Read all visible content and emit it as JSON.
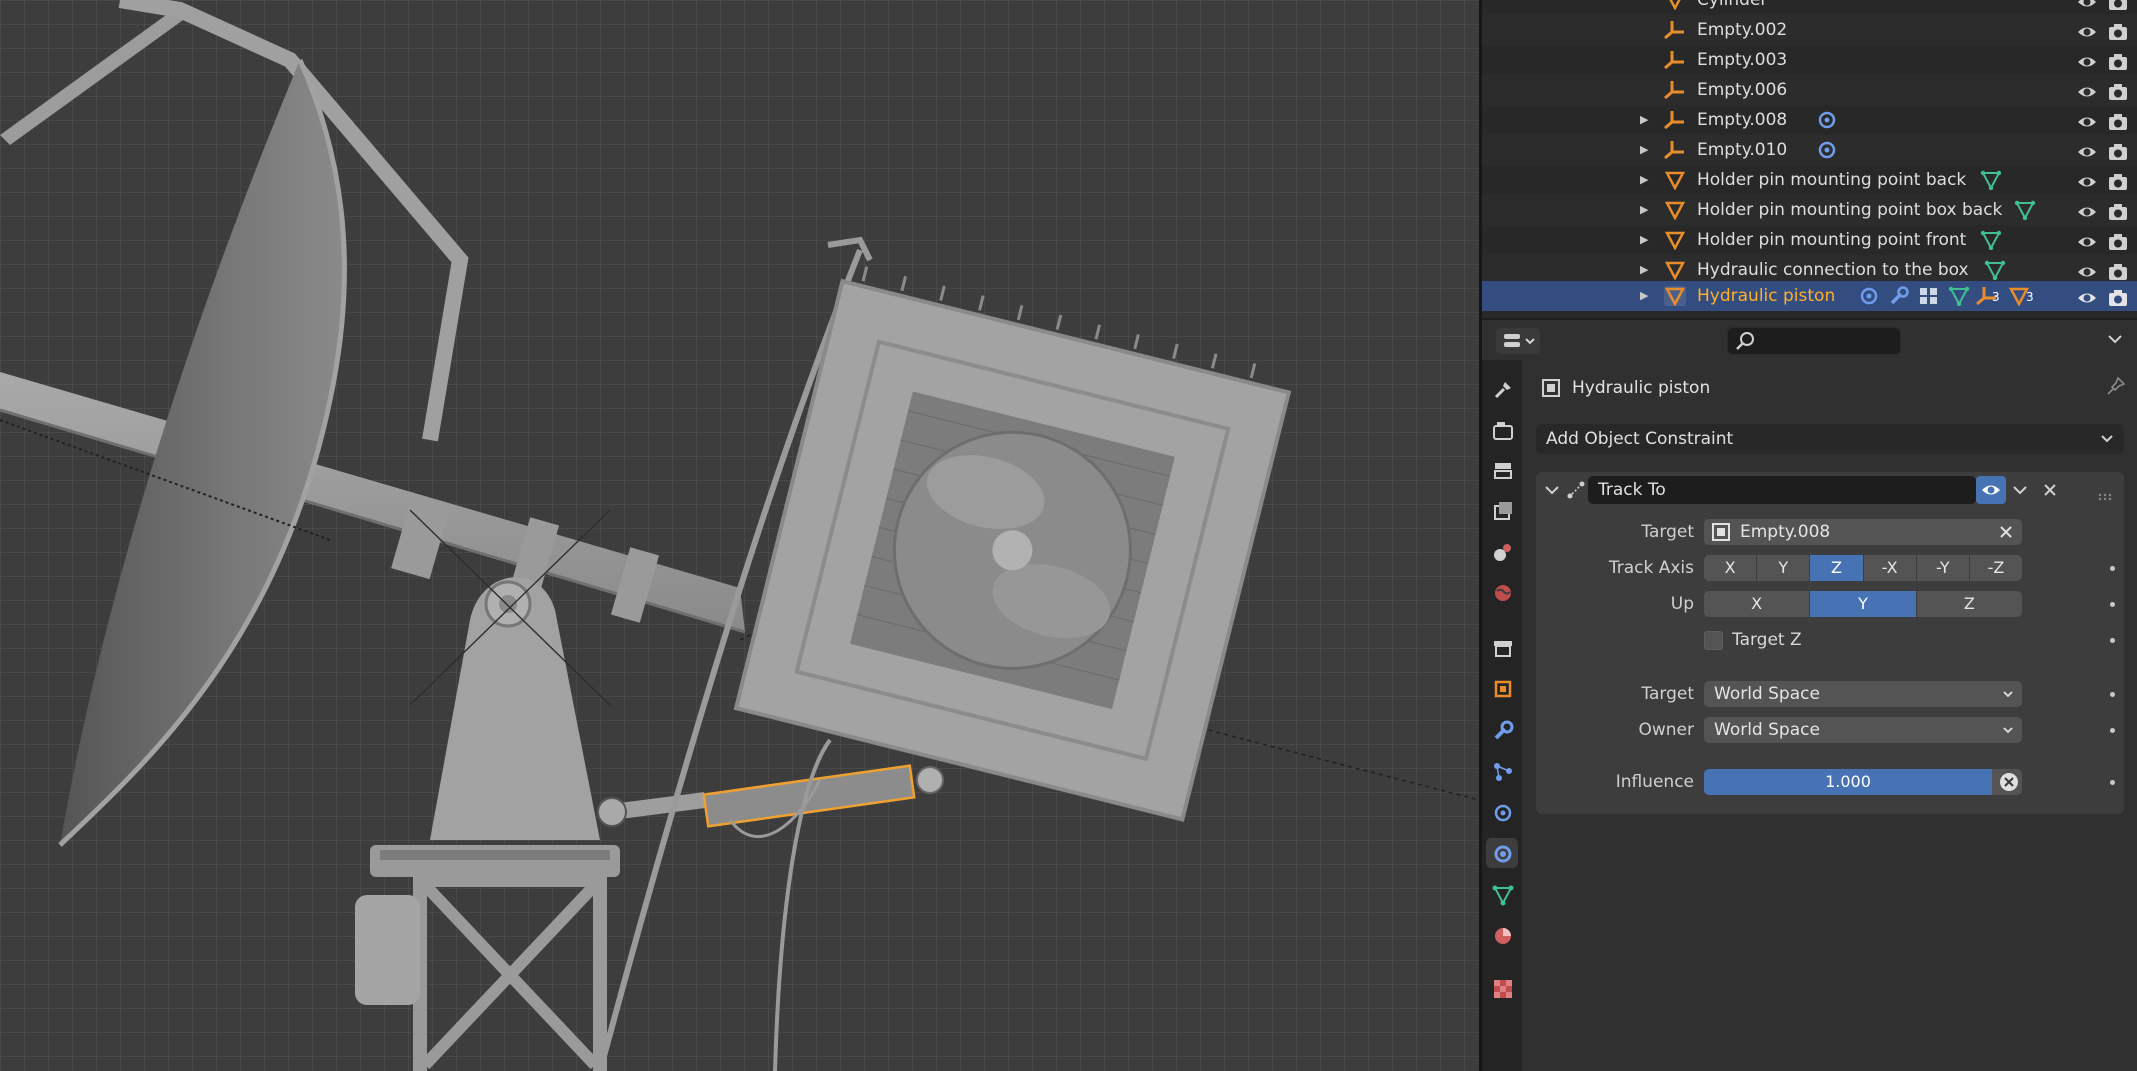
{
  "outliner": {
    "rows": [
      {
        "name": "Cylinder",
        "type": "mesh",
        "expandable": false,
        "selected": false
      },
      {
        "name": "Empty.002",
        "type": "empty",
        "expandable": false,
        "selected": false
      },
      {
        "name": "Empty.003",
        "type": "empty",
        "expandable": false,
        "selected": false
      },
      {
        "name": "Empty.006",
        "type": "empty",
        "expandable": false,
        "selected": false
      },
      {
        "name": "Empty.008",
        "type": "empty",
        "expandable": true,
        "selected": false,
        "modifiers": [
          "constraint-icon"
        ]
      },
      {
        "name": "Empty.010",
        "type": "empty",
        "expandable": true,
        "selected": false,
        "modifiers": [
          "constraint-icon"
        ]
      },
      {
        "name": "Holder pin mounting point back",
        "type": "mesh",
        "expandable": true,
        "selected": false,
        "modifiers": [
          "mesh-data-icon"
        ]
      },
      {
        "name": "Holder pin mounting point box back",
        "type": "mesh",
        "expandable": true,
        "selected": false,
        "modifiers": [
          "mesh-data-icon"
        ]
      },
      {
        "name": "Holder pin mounting point front",
        "type": "mesh",
        "expandable": true,
        "selected": false,
        "modifiers": [
          "mesh-data-icon"
        ]
      },
      {
        "name": "Hydraulic connection to the box",
        "type": "mesh",
        "expandable": true,
        "selected": false,
        "modifiers": [
          "mesh-data-icon"
        ]
      },
      {
        "name": "Hydraulic piston",
        "type": "mesh",
        "expandable": true,
        "selected": true,
        "modifiers": [
          "constraint-icon",
          "wrench-icon",
          "grid-icon",
          "mesh-data-icon",
          "empty-child-icon",
          "mesh-child-icon"
        ],
        "badges": [
          "3",
          "3"
        ]
      }
    ]
  },
  "properties": {
    "object_name": "Hydraulic piston",
    "add_constraint_label": "Add Object Constraint",
    "constraint": {
      "name": "Track To",
      "target_label": "Target",
      "target_value": "Empty.008",
      "track_axis_label": "Track Axis",
      "track_axis_options": [
        "X",
        "Y",
        "Z",
        "-X",
        "-Y",
        "-Z"
      ],
      "track_axis_selected": "Z",
      "up_label": "Up",
      "up_options": [
        "X",
        "Y",
        "Z"
      ],
      "up_selected": "Y",
      "target_z_label": "Target Z",
      "target_z_checked": false,
      "target_space_label": "Target",
      "target_space_value": "World Space",
      "owner_space_label": "Owner",
      "owner_space_value": "World Space",
      "influence_label": "Influence",
      "influence_value": "1.000",
      "influence_fraction": 1.0
    }
  },
  "colors": {
    "selection": "#334d80",
    "accent_blue": "#4772b3",
    "selected_text": "#ffaf29",
    "object_orange": "#e98c2c",
    "mesh_green": "#40c090",
    "constraint_blue": "#6f9ceb"
  }
}
